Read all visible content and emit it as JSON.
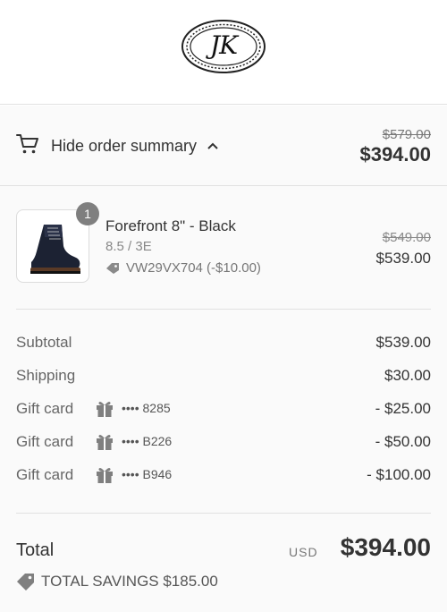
{
  "header": {
    "logo_text": "JK"
  },
  "summary_toggle": {
    "label": "Hide order summary",
    "original_total": "$579.00",
    "total": "$394.00"
  },
  "product": {
    "quantity": "1",
    "name": "Forefront 8\" - Black",
    "variant": "8.5 / 3E",
    "discount": "VW29VX704 (-$10.00)",
    "original_price": "$549.00",
    "price": "$539.00"
  },
  "lines": {
    "subtotal": {
      "label": "Subtotal",
      "value": "$539.00"
    },
    "shipping": {
      "label": "Shipping",
      "value": "$30.00"
    },
    "gift_cards": [
      {
        "label": "Gift card",
        "code": "•••• 8285",
        "value": "- $25.00"
      },
      {
        "label": "Gift card",
        "code": "•••• B226",
        "value": "- $50.00"
      },
      {
        "label": "Gift card",
        "code": "•••• B946",
        "value": "- $100.00"
      }
    ]
  },
  "total": {
    "label": "Total",
    "currency": "USD",
    "value": "$394.00"
  },
  "savings": {
    "text": "TOTAL SAVINGS $185.00"
  },
  "icons": {
    "cart": "cart-icon",
    "chevron": "chevron-up-icon",
    "tag": "tag-icon",
    "gift": "gift-icon"
  }
}
